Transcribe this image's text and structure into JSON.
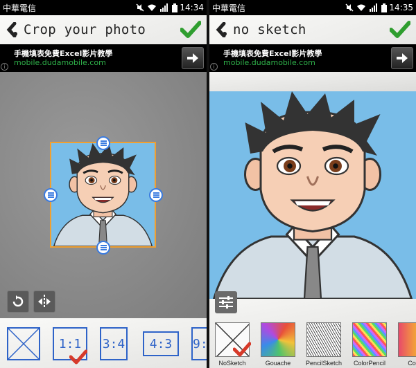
{
  "left_screen": {
    "status": {
      "carrier": "中華電信",
      "time": "14:34"
    },
    "title": "Crop your photo",
    "ad": {
      "title": "手機填表免費Excel影片教學",
      "url": "mobile.dudamobile.com",
      "info": "i"
    },
    "tools": {
      "rotate": "rotate-icon",
      "flip": "flip-icon"
    },
    "ratios": [
      {
        "label": ""
      },
      {
        "label": "1:1",
        "selected": true
      },
      {
        "label": "3:4"
      },
      {
        "label": "4:3"
      },
      {
        "label": "9:"
      }
    ]
  },
  "right_screen": {
    "status": {
      "carrier": "中華電信",
      "time": "14:35"
    },
    "title": "no sketch",
    "ad": {
      "title": "手機填表免費Excel影片教學",
      "url": "mobile.dudamobile.com",
      "info": "i"
    },
    "filters": [
      {
        "label": "NoSketch",
        "selected": true
      },
      {
        "label": "Gouache"
      },
      {
        "label": "PencilSketch"
      },
      {
        "label": "ColorPencil"
      },
      {
        "label": "Color"
      }
    ]
  },
  "colors": {
    "accent_check": "#2f9e2f",
    "crop_border": "#f0a030",
    "ratio_blue": "#2e63c8",
    "ad_url": "#2fb24a"
  }
}
